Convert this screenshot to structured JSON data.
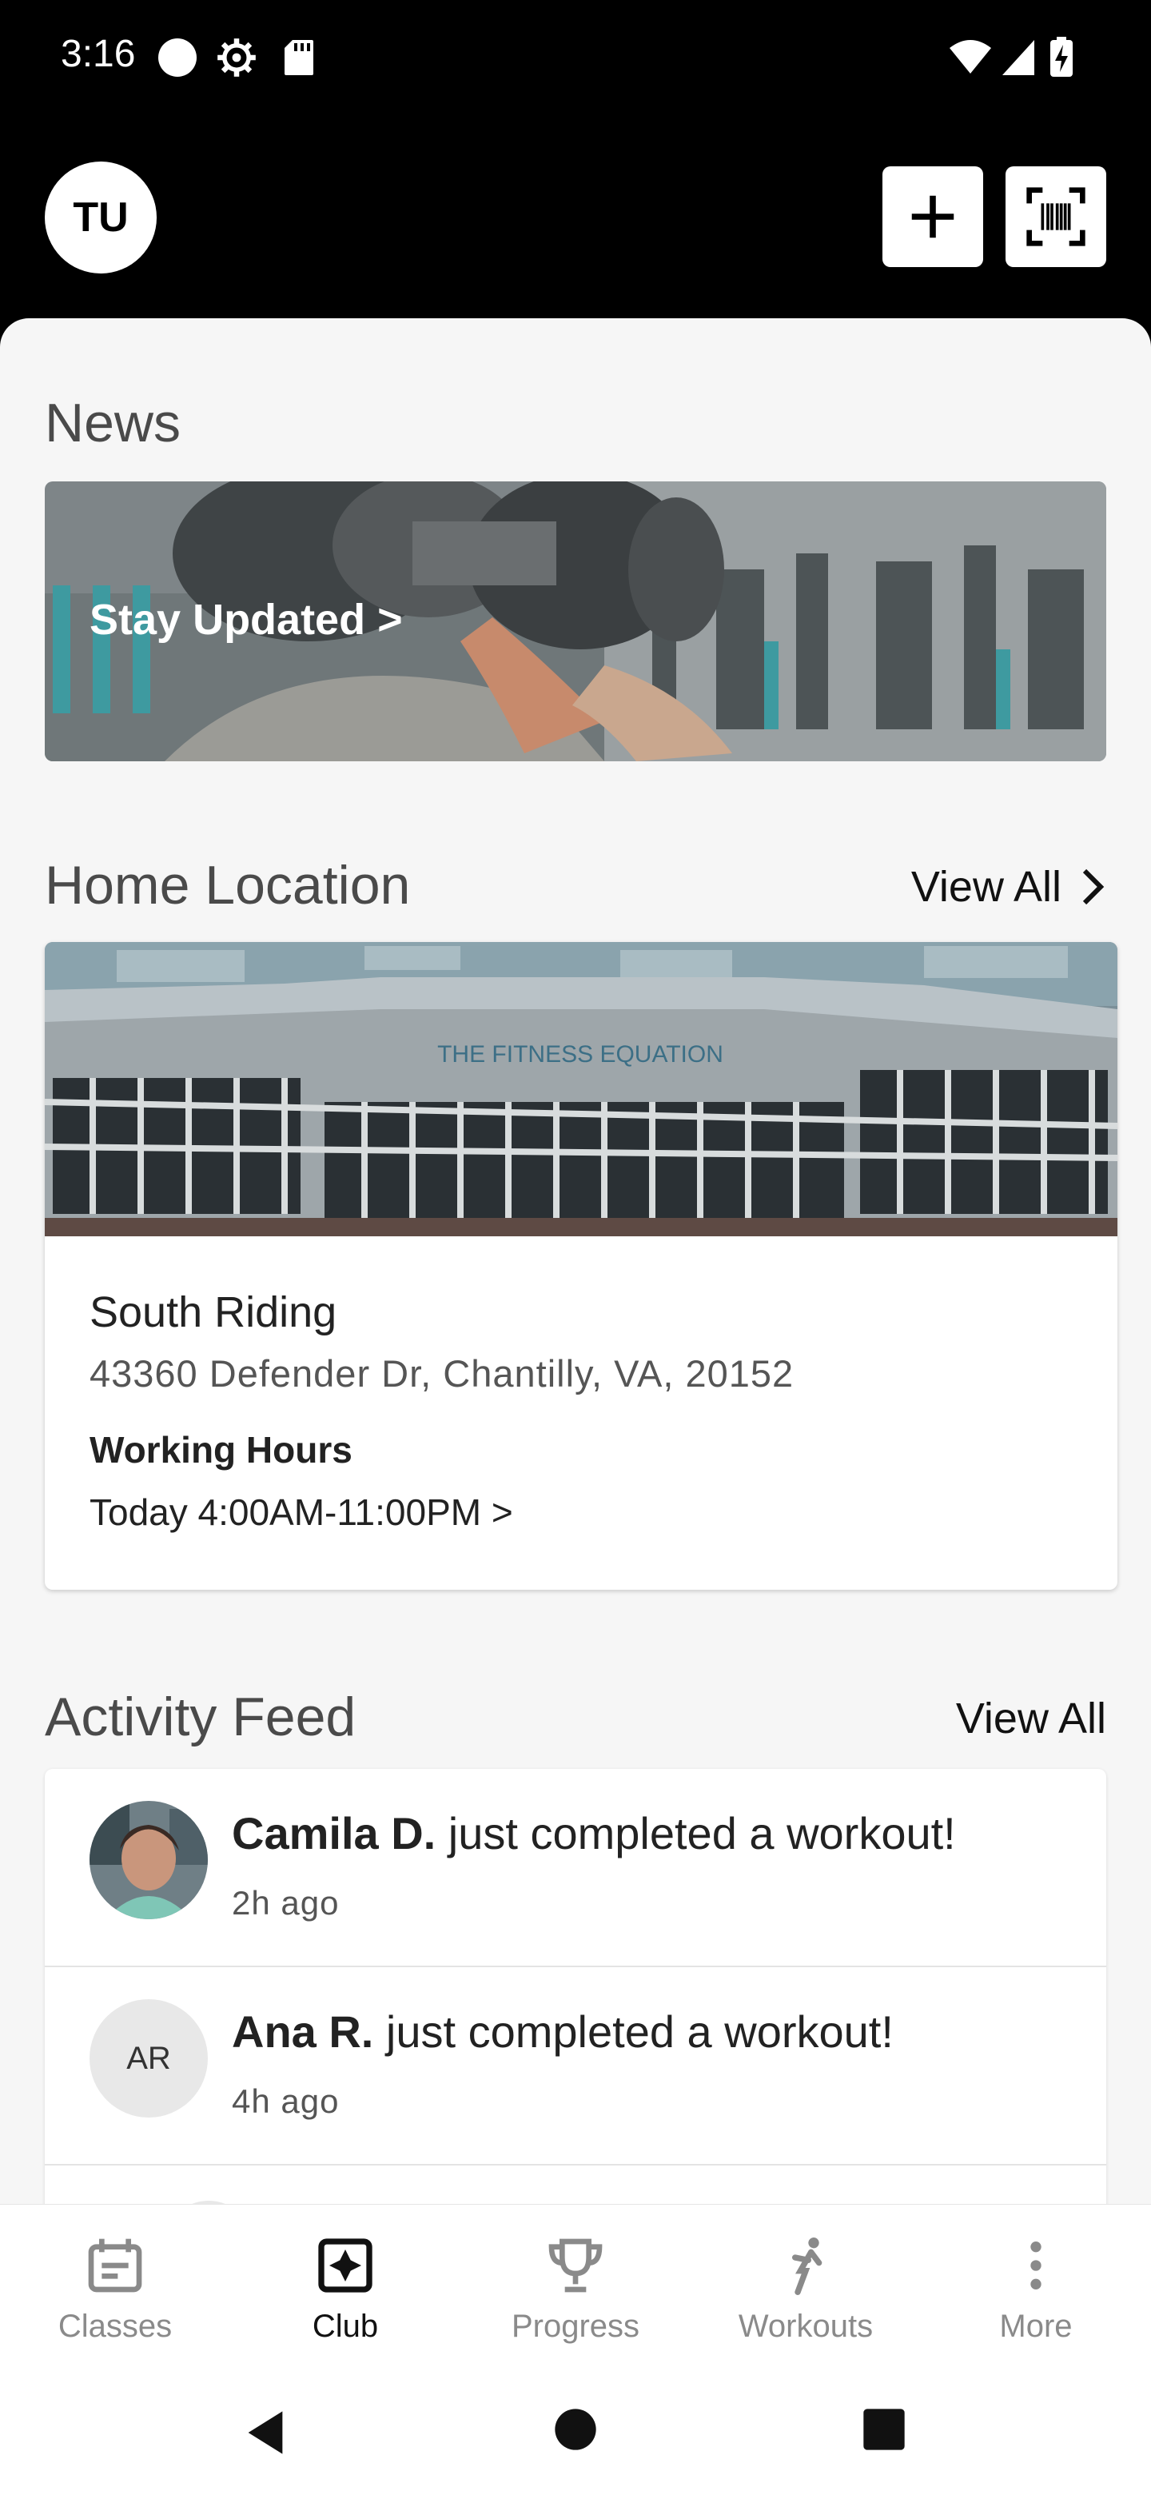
{
  "status_bar": {
    "time": "3:16",
    "icons": [
      "notification-dot-icon",
      "gear-icon",
      "sd-card-icon",
      "wifi-icon",
      "signal-icon",
      "battery-charging-icon"
    ]
  },
  "header": {
    "avatar_initials": "TU",
    "add_icon": "plus-icon",
    "scan_icon": "barcode-scan-icon"
  },
  "news": {
    "title": "News",
    "banner_text": "Stay Updated >"
  },
  "home_location": {
    "title": "Home Location",
    "view_all": "View All",
    "name": "South Riding",
    "address": "43360 Defender Dr, Chantilly, VA, 20152",
    "hours_label": "Working Hours",
    "hours": "Today 4:00AM-11:00PM >",
    "image_sign": "THE FITNESS EQUATION"
  },
  "activity_feed": {
    "title": "Activity Feed",
    "view_all": "View All",
    "items": [
      {
        "name": "Camila D.",
        "action": " just completed a workout!",
        "time": "2h ago",
        "avatar": "photo"
      },
      {
        "name": "Ana R.",
        "action": " just completed a workout!",
        "time": "4h ago",
        "initials": "AR"
      }
    ]
  },
  "bottom_nav": {
    "items": [
      {
        "label": "Classes",
        "icon": "calendar-icon",
        "active": false
      },
      {
        "label": "Club",
        "icon": "club-icon",
        "active": true
      },
      {
        "label": "Progress",
        "icon": "trophy-icon",
        "active": false
      },
      {
        "label": "Workouts",
        "icon": "workout-figure-icon",
        "active": false
      },
      {
        "label": "More",
        "icon": "more-vertical-icon",
        "active": false
      }
    ]
  },
  "colors": {
    "header_bg": "#000000",
    "content_bg": "#f6f6f6",
    "active_nav": "#111111",
    "inactive_nav": "#8a8a8a"
  }
}
